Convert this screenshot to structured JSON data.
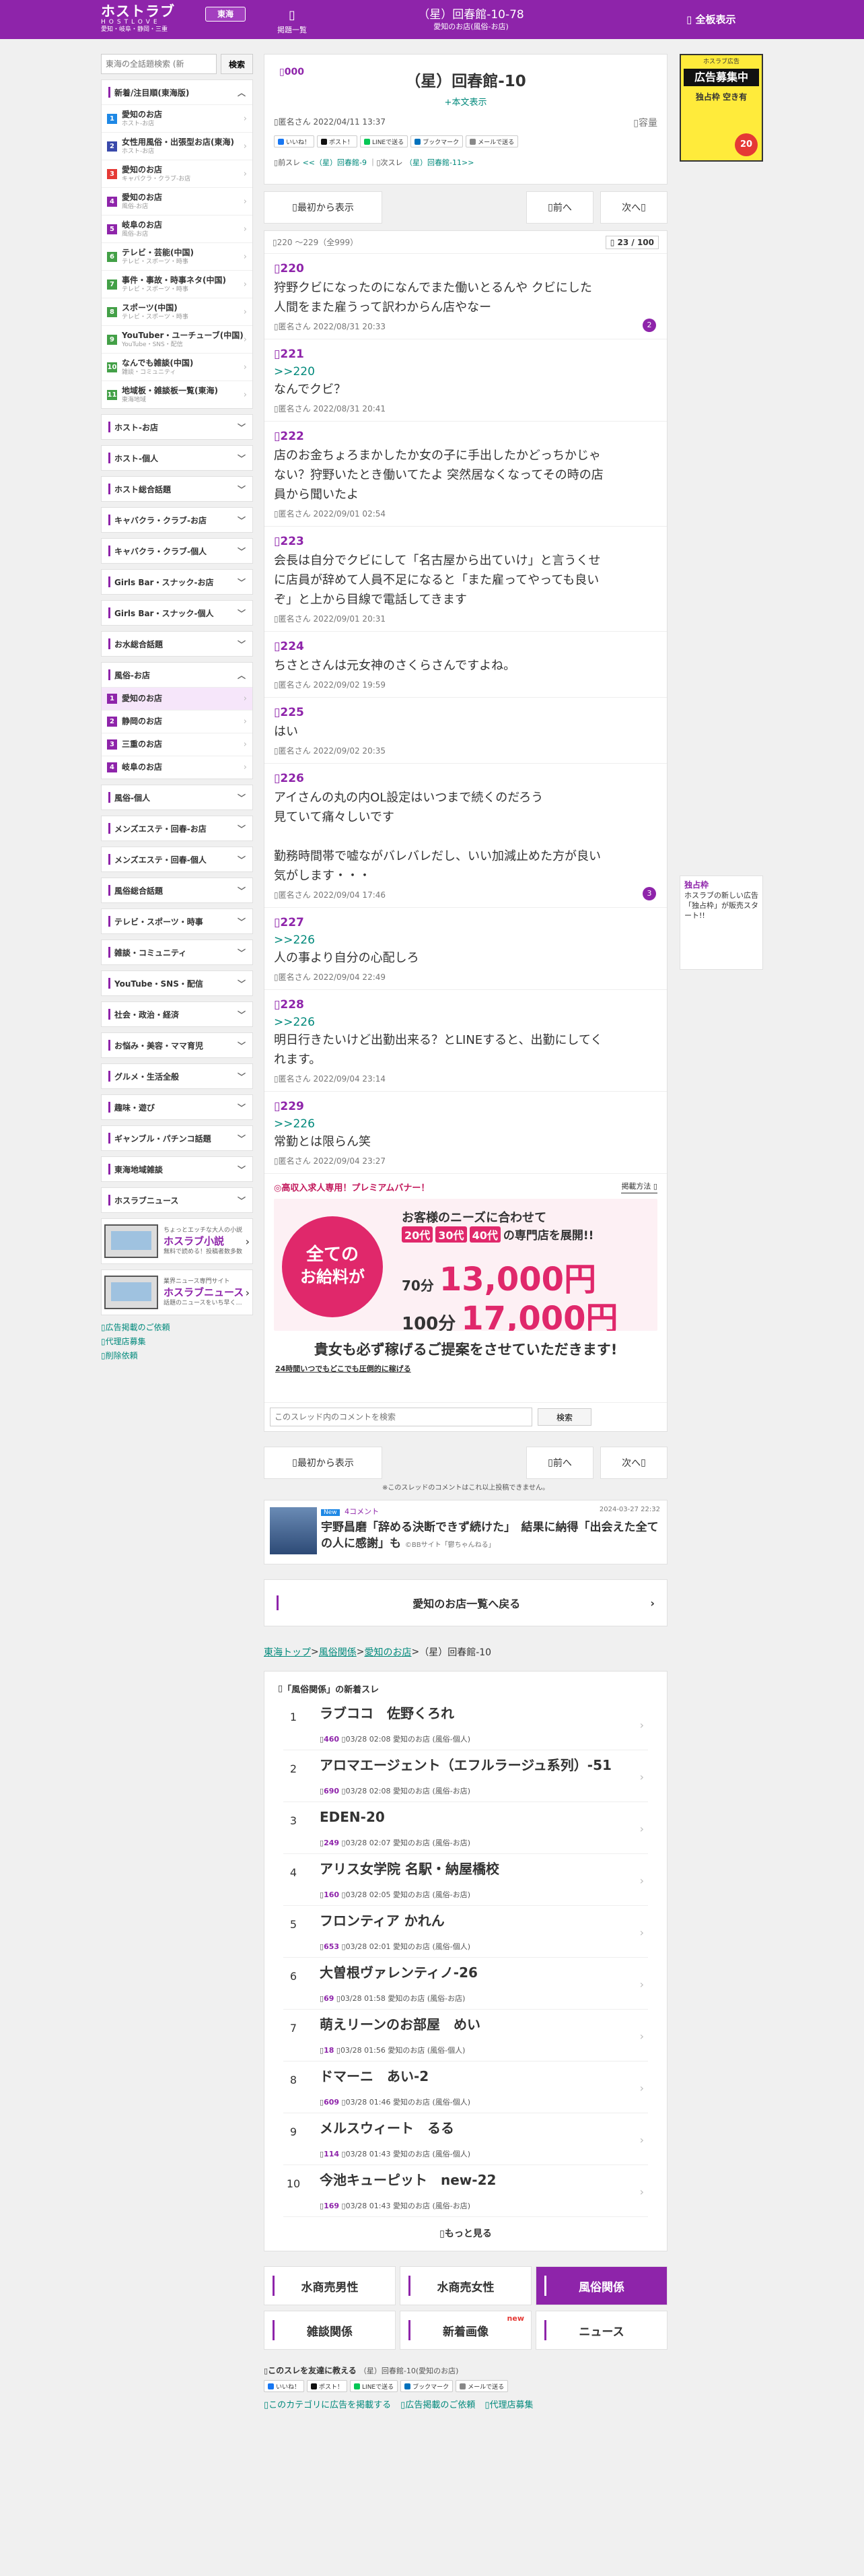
{
  "header": {
    "logo_line1": "ホストラブ",
    "logo_line2": "HOSTLOVE",
    "logo_line3": "愛知・岐阜・静岡・三重",
    "area_badge": "東海",
    "menu_label": "掲題一覧",
    "title": "（星）回春館-10-78",
    "subtitle": "愛知のお店(風俗-お店)",
    "fullscreen_label": "全板表示"
  },
  "sidebar": {
    "search_placeholder": "東海の全話題検索 (新",
    "search_button": "検索",
    "groups": [
      {
        "title": "新着/注目順(東海版)",
        "open": true,
        "items": [
          {
            "num": "1",
            "color": "#1e88e5",
            "label": "愛知のお店",
            "sub": "ホスト-お店"
          },
          {
            "num": "2",
            "color": "#3949ab",
            "label": "女性用風俗・出張型お店(東海)",
            "sub": "ホスト-お店"
          },
          {
            "num": "3",
            "color": "#e53935",
            "label": "愛知のお店",
            "sub": "キャバクラ・クラブ-お店"
          },
          {
            "num": "4",
            "color": "#8e24aa",
            "label": "愛知のお店",
            "sub": "風俗-お店"
          },
          {
            "num": "5",
            "color": "#8e24aa",
            "label": "岐阜のお店",
            "sub": "風俗-お店"
          },
          {
            "num": "6",
            "color": "#43a047",
            "label": "テレビ・芸能(中国)",
            "sub": "テレビ・スポーツ・時事"
          },
          {
            "num": "7",
            "color": "#43a047",
            "label": "事件・事故・時事ネタ(中国)",
            "sub": "テレビ・スポーツ・時事"
          },
          {
            "num": "8",
            "color": "#43a047",
            "label": "スポーツ(中国)",
            "sub": "テレビ・スポーツ・時事"
          },
          {
            "num": "9",
            "color": "#43a047",
            "label": "YouTuber・ユーチューブ(中国)",
            "sub": "YouTube・SNS・配信"
          },
          {
            "num": "10",
            "color": "#43a047",
            "label": "なんでも雑談(中国)",
            "sub": "雑談・コミュニティ"
          },
          {
            "num": "11",
            "color": "#43a047",
            "label": "地域板・雑談板一覧(東海)",
            "sub": "東海地域"
          }
        ]
      },
      {
        "title": "ホスト-お店"
      },
      {
        "title": "ホスト-個人"
      },
      {
        "title": "ホスト総合話題"
      },
      {
        "title": "キャバクラ・クラブ-お店"
      },
      {
        "title": "キャバクラ・クラブ-個人"
      },
      {
        "title": "Girls Bar・スナック-お店"
      },
      {
        "title": "Girls Bar・スナック-個人"
      },
      {
        "title": "お水総合話題"
      },
      {
        "title": "風俗-お店",
        "open": true,
        "items": [
          {
            "num": "1",
            "color": "#8e24aa",
            "label": "愛知のお店",
            "active": true
          },
          {
            "num": "2",
            "color": "#8e24aa",
            "label": "静岡のお店"
          },
          {
            "num": "3",
            "color": "#8e24aa",
            "label": "三重のお店"
          },
          {
            "num": "4",
            "color": "#8e24aa",
            "label": "岐阜のお店"
          }
        ]
      },
      {
        "title": "風俗-個人"
      },
      {
        "title": "メンズエステ・回春-お店"
      },
      {
        "title": "メンズエステ・回春-個人"
      },
      {
        "title": "風俗総合話題"
      },
      {
        "title": "テレビ・スポーツ・時事"
      },
      {
        "title": "雑談・コミュニティ"
      },
      {
        "title": "YouTube・SNS・配信"
      },
      {
        "title": "社会・政治・経済"
      },
      {
        "title": "お悩み・美容・ママ育児"
      },
      {
        "title": "グルメ・生活全般"
      },
      {
        "title": "趣味・遊び"
      },
      {
        "title": "ギャンブル・パチンコ話題"
      },
      {
        "title": "東海地域雑談"
      },
      {
        "title": "ホスラブニュース"
      }
    ],
    "banners": [
      {
        "line1": "ちょっとエッチな大人の小説",
        "line2": "ホスラブ小説",
        "line3": "無料で読める！投稿者数多数"
      },
      {
        "line1": "業界ニュース専門サイト",
        "line2": "ホスラブニュース",
        "line3": "話題のニュースをいち早くお届け"
      }
    ],
    "links": [
      "広告掲載のご依頼",
      "代理店募集",
      "削除依頼"
    ]
  },
  "thread": {
    "num": "000",
    "title": "（星）回春館-10",
    "more_label": "+本文表示",
    "author": "匿名さん",
    "date": "2022/04/11 13:37",
    "capacity": "容量",
    "nav_prev_label": "前スレ",
    "nav_prev_title": "（星）回春館-9",
    "nav_next_label": "次スレ",
    "nav_next_title": "（星）回春館-11"
  },
  "share_buttons": [
    {
      "label": "いいね！",
      "color": "#1877f2"
    },
    {
      "label": "ポスト！",
      "color": "#111111"
    },
    {
      "label": "LINEで送る",
      "color": "#06c755"
    },
    {
      "label": "ブックマーク",
      "color": "#0071bc"
    },
    {
      "label": "メールで送る",
      "color": "#888888"
    }
  ],
  "nav": {
    "first": "最初から表示",
    "prev": "前へ",
    "next": "次へ"
  },
  "posts_header": {
    "range": "220 〜229（全999）",
    "page": "23 / 100"
  },
  "posts": [
    {
      "num": "220",
      "body": [
        "狩野クビになったのになんでまた働いとるんや クビにした",
        "人間をまた雇うって訳わからん店やなー"
      ],
      "author": "匿名さん",
      "date": "2022/08/31 20:33",
      "replies": "2"
    },
    {
      "num": "221",
      "reply_to": ">>220",
      "body": [
        "なんでクビ？"
      ],
      "author": "匿名さん",
      "date": "2022/08/31 20:41"
    },
    {
      "num": "222",
      "body": [
        "店のお金ちょろまかしたか女の子に手出したかどっちかじゃ",
        "ない？狩野いたとき働いてたよ 突然居なくなってその時の店",
        "員から聞いたよ"
      ],
      "author": "匿名さん",
      "date": "2022/09/01 02:54"
    },
    {
      "num": "223",
      "body": [
        "会長は自分でクビにして「名古屋から出ていけ」と言うくせ",
        "に店員が辞めて人員不足になると「また雇ってやっても良い",
        "ぞ」と上から目線で電話してきます"
      ],
      "author": "匿名さん",
      "date": "2022/09/01 20:31"
    },
    {
      "num": "224",
      "body": [
        "ちさとさんは元女神のさくらさんですよね。"
      ],
      "author": "匿名さん",
      "date": "2022/09/02 19:59"
    },
    {
      "num": "225",
      "body": [
        "はい"
      ],
      "author": "匿名さん",
      "date": "2022/09/02 20:35"
    },
    {
      "num": "226",
      "body": [
        "アイさんの丸の内OL設定はいつまで続くのだろう",
        "見ていて痛々しいです",
        "",
        "勤務時間帯で嘘ながバレバレだし、いい加減止めた方が良い",
        "気がします・・・"
      ],
      "author": "匿名さん",
      "date": "2022/09/04 17:46",
      "replies": "3"
    },
    {
      "num": "227",
      "reply_to": ">>226",
      "body": [
        "人の事より自分の心配しろ"
      ],
      "author": "匿名さん",
      "date": "2022/09/04 22:49"
    },
    {
      "num": "228",
      "reply_to": ">>226",
      "body": [
        "明日行きたいけど出勤出来る？とLINEすると、出勤にしてく",
        "れます。"
      ],
      "author": "匿名さん",
      "date": "2022/09/04 23:14"
    },
    {
      "num": "229",
      "reply_to": ">>226",
      "body": [
        "常勤とは限らん笑"
      ],
      "author": "匿名さん",
      "date": "2022/09/04 23:27"
    }
  ],
  "premium": {
    "title": "◎高収入求人専用！プレミアムバナー！",
    "help": "掲載方法",
    "ad_circle1": "全ての",
    "ad_circle2": "お給料が",
    "ad_line1": "お客様のニーズに合わせて",
    "ad_tags": [
      "20代",
      "30代",
      "40代"
    ],
    "ad_tag_suffix": "の専門店を展開!!",
    "ad_price1_label": "70分",
    "ad_price1": "13,000円",
    "ad_price2_label": "100分",
    "ad_price2": "17,000円",
    "caption": "貴女も必ず稼げるご提案をさせていただきます!",
    "link": "24時間いつでもどこでも圧倒的に稼げる"
  },
  "comment_search": {
    "placeholder": "このスレッド内のコメントを検索",
    "button": "検索"
  },
  "note": "※このスレッドのコメントはこれ以上投稿できません。",
  "news": {
    "badge": "New",
    "comments": "4コメント",
    "date": "2024-03-27 22:32",
    "title": "宇野昌磨「辞める決断できず続けた」　結果に納得「出会えた全ての人に感謝」も",
    "source": "©BBサイト「鬱ちゃんねる」"
  },
  "back_to_list": "愛知のお店一覧へ戻る",
  "breadcrumb": [
    "東海トップ",
    "風俗関係",
    "愛知のお店",
    "（星）回春館-10"
  ],
  "new_threads": {
    "header": "「風俗関係」の新着スレ",
    "items": [
      {
        "rank": "1",
        "name": "ラブココ　佐野くろれ",
        "count": "460",
        "date": "03/28 02:08",
        "board": "愛知のお店",
        "cat": "(風俗-個人)"
      },
      {
        "rank": "2",
        "name": "アロマエージェント（エフルラージュ系列）-51",
        "count": "690",
        "date": "03/28 02:08",
        "board": "愛知のお店",
        "cat": "(風俗-お店)"
      },
      {
        "rank": "3",
        "name": "EDEN-20",
        "count": "249",
        "date": "03/28 02:07",
        "board": "愛知のお店",
        "cat": "(風俗-お店)"
      },
      {
        "rank": "4",
        "name": "アリス女学院 名駅・納屋橋校",
        "count": "160",
        "date": "03/28 02:05",
        "board": "愛知のお店",
        "cat": "(風俗-お店)"
      },
      {
        "rank": "5",
        "name": "フロンティア かれん",
        "count": "653",
        "date": "03/28 02:01",
        "board": "愛知のお店",
        "cat": "(風俗-個人)"
      },
      {
        "rank": "6",
        "name": "大曽根ヴァレンティノ-26",
        "count": "69",
        "date": "03/28 01:58",
        "board": "愛知のお店",
        "cat": "(風俗-お店)"
      },
      {
        "rank": "7",
        "name": "萌えリーンのお部屋　めい",
        "count": "18",
        "date": "03/28 01:56",
        "board": "愛知のお店",
        "cat": "(風俗-個人)"
      },
      {
        "rank": "8",
        "name": "ドマーニ　あい-2",
        "count": "609",
        "date": "03/28 01:46",
        "board": "愛知のお店",
        "cat": "(風俗-個人)"
      },
      {
        "rank": "9",
        "name": "メルスウィート　るる",
        "count": "114",
        "date": "03/28 01:43",
        "board": "愛知のお店",
        "cat": "(風俗-個人)"
      },
      {
        "rank": "10",
        "name": "今池キューピット　new-22",
        "count": "169",
        "date": "03/28 01:43",
        "board": "愛知のお店",
        "cat": "(風俗-お店)"
      }
    ],
    "more": "もっと見る"
  },
  "categories": [
    {
      "label": "水商売男性"
    },
    {
      "label": "水商売女性"
    },
    {
      "label": "風俗関係",
      "active": true
    },
    {
      "label": "雑談関係"
    },
    {
      "label": "新着画像",
      "badge": "new"
    },
    {
      "label": "ニュース"
    }
  ],
  "footer": {
    "share_title": "このスレを友達に教える",
    "share_sub": "（星）回春館-10(愛知のお店)",
    "links": [
      "このカテゴリに広告を掲載する",
      "広告掲載のご依頼",
      "代理店募集"
    ]
  },
  "right_ad": {
    "line1": "ホスラブ広告",
    "line2": "広告募集中",
    "line3": "独占枠 空き有",
    "badge": "20"
  },
  "right_ad2": {
    "head": "独占枠",
    "body": "ホスラブの新しい広告「独占枠」が販売スタート!!"
  }
}
